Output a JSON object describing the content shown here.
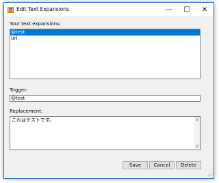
{
  "window": {
    "title": "Edit Text Expansions",
    "minimize_glyph": "—",
    "maximize_glyph": "☐",
    "close_glyph": "✕"
  },
  "expansions": {
    "label": "Your text expansions:",
    "items": [
      "@test",
      "url"
    ],
    "selected_index": 0
  },
  "trigger": {
    "label": "Trigger:",
    "value": "@test"
  },
  "replacement": {
    "label": "Replacement:",
    "value": "これはテストです。"
  },
  "buttons": {
    "save": "Save",
    "cancel": "Cancel",
    "delete": "Delete"
  },
  "colors": {
    "selection": "#0078d7",
    "window_border": "#1f6fc0"
  }
}
